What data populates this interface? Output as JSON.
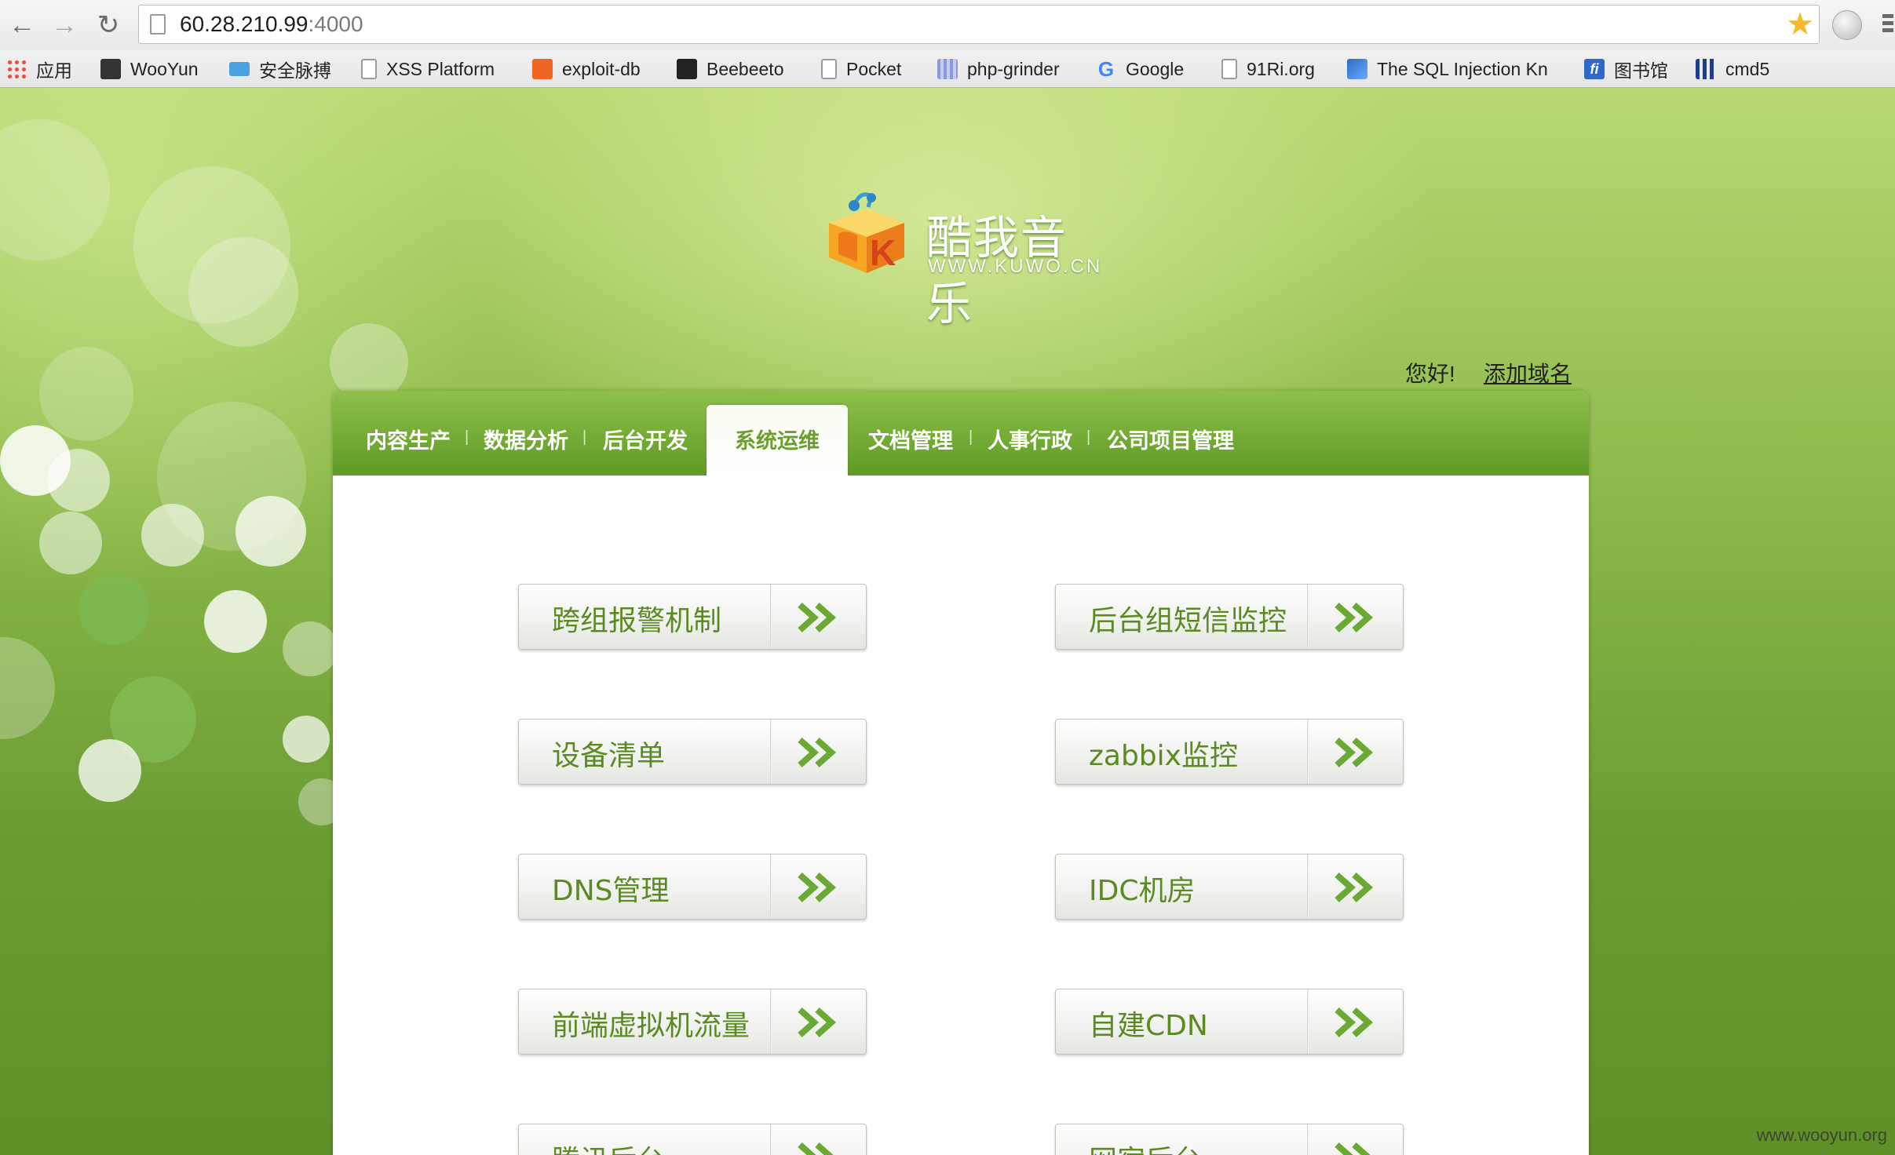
{
  "browser": {
    "url_host": "60.28.210.99",
    "url_port": ":4000",
    "bookmarks": [
      {
        "label": "应用",
        "icon": "apps-grid-icon"
      },
      {
        "label": "WooYun",
        "icon": "wooyun-icon"
      },
      {
        "label": "安全脉搏",
        "icon": "cloud-icon"
      },
      {
        "label": "XSS Platform",
        "icon": "page-icon"
      },
      {
        "label": "exploit-db",
        "icon": "exploit-db-icon"
      },
      {
        "label": "Beebeeto",
        "icon": "beebeeto-icon"
      },
      {
        "label": "Pocket",
        "icon": "page-icon"
      },
      {
        "label": "php-grinder",
        "icon": "grid-icon"
      },
      {
        "label": "Google",
        "icon": "google-icon"
      },
      {
        "label": "91Ri.org",
        "icon": "page-icon"
      },
      {
        "label": "The SQL Injection Kn",
        "icon": "sql-icon"
      },
      {
        "label": "图书馆",
        "icon": "library-icon"
      },
      {
        "label": "cmd5",
        "icon": "cmd5-icon"
      }
    ]
  },
  "logo": {
    "title": "酷我音乐",
    "subtitle": "WWW.KUWO.CN",
    "badge_letter": "K"
  },
  "user_bar": {
    "greeting": "您好!",
    "add_domain": "添加域名"
  },
  "menu": {
    "items": [
      "内容生产",
      "数据分析",
      "后台开发",
      "系统运维",
      "文档管理",
      "人事行政",
      "公司项目管理"
    ],
    "active": "系统运维",
    "separator": "|"
  },
  "buttons": {
    "left": [
      "跨组报警机制",
      "设备清单",
      "DNS管理",
      "前端虚拟机流量",
      "腾讯后台"
    ],
    "right": [
      "后台组短信监控",
      "zabbix监控",
      "IDC机房",
      "自建CDN",
      "网宿后台"
    ]
  },
  "watermark": "www.wooyun.org",
  "colors": {
    "menu_green": "#6fa72f",
    "button_text": "#5a8a22",
    "arrow_green": "#6aaa34"
  }
}
